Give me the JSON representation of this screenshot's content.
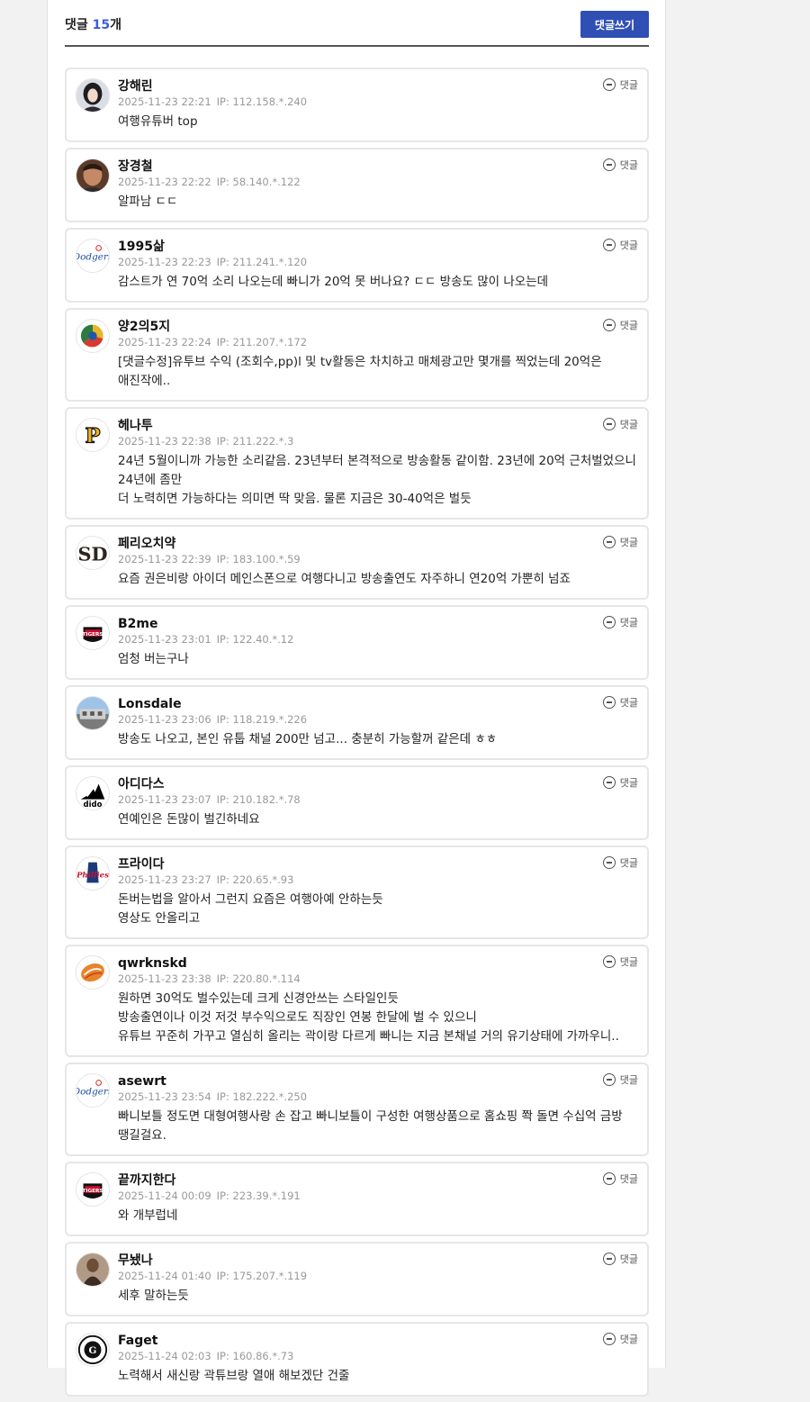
{
  "header": {
    "title": "댓글",
    "count": "15",
    "unit": "개",
    "write_button": "댓글쓰기"
  },
  "reply_label": "댓글",
  "comments": [
    {
      "nick": "강해린",
      "date": "2025-11-23 22:21",
      "ip": "IP: 112.158.*.240",
      "text": "여행유튜버 top",
      "avatar": "photo-person-icon"
    },
    {
      "nick": "장경철",
      "date": "2025-11-23 22:22",
      "ip": "IP: 58.140.*.122",
      "text": "알파남 ㄷㄷ",
      "avatar": "photo-man-icon"
    },
    {
      "nick": "1995삶",
      "date": "2025-11-23 22:23",
      "ip": "IP: 211.241.*.120",
      "text": "감스트가 연 70억 소리 나오는데 빠니가 20억 못 버나요? ㄷㄷ 방송도 많이 나오는데",
      "avatar": "dodgers-logo-icon"
    },
    {
      "nick": "양2의5지",
      "date": "2025-11-23 22:24",
      "ip": "IP: 211.207.*.172",
      "text": "[댓글수정]유투브 수익 (조회수,pp)l 및 tv활동은 차치하고 매체광고만 몇개를 찍었는데 20억은 애진작에..",
      "avatar": "wbc-logo-icon"
    },
    {
      "nick": "헤나투",
      "date": "2025-11-23 22:38",
      "ip": "IP: 211.222.*.3",
      "text": "24년 5월이니까 가능한 소리같음. 23년부터 본격적으로 방송활동 같이함. 23년에 20억 근처벌었으니 24년에 좀만\n더 노력히면 가능하다는 의미면 딱 맞음. 물론 지금은 30-40억은 벌듯",
      "avatar": "pirates-logo-icon"
    },
    {
      "nick": "페리오치약",
      "date": "2025-11-23 22:39",
      "ip": "IP: 183.100.*.59",
      "text": "요즘 권은비랑 아이더 메인스폰으로 여행다니고 방송출연도 자주하니 연20억 가뿐히 넘죠",
      "avatar": "padres-logo-icon"
    },
    {
      "nick": "B2me",
      "date": "2025-11-23 23:01",
      "ip": "IP: 122.40.*.12",
      "text": "엄청 버는구나",
      "avatar": "tigers-logo-icon"
    },
    {
      "nick": "Lonsdale",
      "date": "2025-11-23 23:06",
      "ip": "IP: 118.219.*.226",
      "text": "방송도 나오고, 본인 유툽 채널 200만 넘고... 충분히 가능할꺼 같은데 ㅎㅎ",
      "avatar": "building-photo-icon"
    },
    {
      "nick": "아디다스",
      "date": "2025-11-23 23:07",
      "ip": "IP: 210.182.*.78",
      "text": "연예인은 돈많이 벌긴하네요",
      "avatar": "adidas-logo-icon"
    },
    {
      "nick": "프라이다",
      "date": "2025-11-23 23:27",
      "ip": "IP: 220.65.*.93",
      "text": "돈버는법을 알아서 그런지 요즘은 여행아예 안하는듯\n영상도 안올리고",
      "avatar": "phillies-logo-icon"
    },
    {
      "nick": "qwrknskd",
      "date": "2025-11-23 23:38",
      "ip": "IP: 220.80.*.114",
      "text": "원하면 30억도 벌수있는데 크게 신경안쓰는 스타일인듯\n방송출연이나 이것 저것 부수익으로도 직장인 연봉 한달에 벌 수 있으니\n유튜브 꾸준히 가꾸고 열심히 올리는 곽이랑 다르게 빠니는 지금 본채널 거의 유기상태에 가까우니..",
      "avatar": "ball-logo-icon"
    },
    {
      "nick": "asewrt",
      "date": "2025-11-23 23:54",
      "ip": "IP: 182.222.*.250",
      "text": "빠니보틀 정도면 대형여행사랑 손 잡고 빠니보틀이 구성한 여행상품으로 홈쇼핑 쫙 돌면 수십억 금방 땡길걸요.",
      "avatar": "dodgers-logo-icon"
    },
    {
      "nick": "끝까지한다",
      "date": "2025-11-24 00:09",
      "ip": "IP: 223.39.*.191",
      "text": "와 개부럽네",
      "avatar": "tigers-logo-icon"
    },
    {
      "nick": "무뇄나",
      "date": "2025-11-24 01:40",
      "ip": "IP: 175.207.*.119",
      "text": "세후 말하는듯",
      "avatar": "photo-figure-icon"
    },
    {
      "nick": "Faget",
      "date": "2025-11-24 02:03",
      "ip": "IP: 160.86.*.73",
      "text": "노력해서 새신랑 곽튜브랑 열애 해보겠단 건줄",
      "avatar": "giants-logo-icon"
    }
  ]
}
